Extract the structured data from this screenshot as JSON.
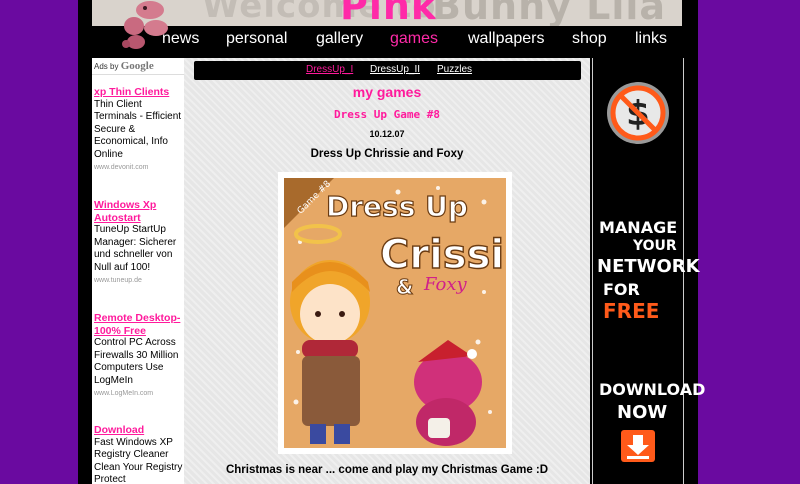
{
  "header": {
    "title_pink": "Pink",
    "title_rest": "Bunny Lila",
    "script_text": "Welcome to"
  },
  "nav": {
    "items": [
      {
        "label": "news",
        "active": false
      },
      {
        "label": "personal",
        "active": false
      },
      {
        "label": "gallery",
        "active": false
      },
      {
        "label": "games",
        "active": true
      },
      {
        "label": "wallpapers",
        "active": false
      },
      {
        "label": "shop",
        "active": false
      },
      {
        "label": "links",
        "active": false
      }
    ]
  },
  "ads": {
    "ads_by": "Ads by",
    "ads_by_brand": "Google",
    "items": [
      {
        "title": "xp Thin Clients",
        "body": "Thin Client Terminals - Efficient Secure & Economical, Info Online",
        "url": "www.devonit.com"
      },
      {
        "title": "Windows Xp Autostart",
        "body": "TuneUp StartUp Manager: Sicherer und schneller von Null auf 100!",
        "url": "www.tuneup.de"
      },
      {
        "title": "Remote Desktop-100% Free",
        "body": "Control PC Across Firewalls 30 Million Computers Use LogMeIn",
        "url": "www.LogMeIn.com"
      },
      {
        "title": "Download",
        "body": "Fast Windows XP Registry Cleaner Clean Your Registry Protect",
        "url": ""
      }
    ]
  },
  "subnav": {
    "items": [
      {
        "label": "DressUp_I",
        "active": true
      },
      {
        "label": "DressUp_II",
        "active": false
      },
      {
        "label": "Puzzles",
        "active": false
      }
    ]
  },
  "content": {
    "heading": "my games",
    "game_label": "Dress Up Game #8",
    "date": "10.12.07",
    "title": "Dress Up Chrissie and Foxy",
    "image_text": {
      "corner": "Game #8",
      "line1": "Dress Up",
      "line2": "Crissi",
      "amp": "&",
      "line3": "Foxy"
    },
    "caption": "Christmas is near ... come and play my Christmas Game :D"
  },
  "banner": {
    "line1": "MANAGE",
    "line2": "YOUR",
    "line3": "NETWORK",
    "line4a": "FOR ",
    "line4b": "FREE",
    "line5": "DOWNLOAD",
    "line6": "NOW"
  },
  "colors": {
    "background": "#6a0aa0",
    "accent_pink": "#ff1a9c",
    "banner_orange": "#ff5a1a"
  }
}
